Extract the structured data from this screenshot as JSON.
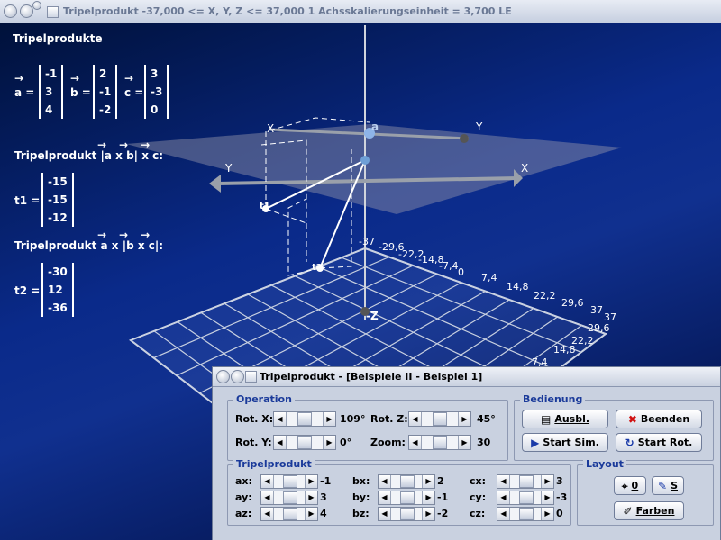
{
  "window": {
    "title": "Tripelprodukt   -37,000 <= X, Y, Z <= 37,000    1 Achsskalierungseinheit = 3,700 LE"
  },
  "scene": {
    "heading": "Tripelprodukte",
    "arrow": "→",
    "vectors": [
      {
        "name": "a",
        "values": [
          "-1",
          "3",
          "4"
        ]
      },
      {
        "name": "b",
        "values": [
          "2",
          "-1",
          "-2"
        ]
      },
      {
        "name": "c",
        "values": [
          "3",
          "-3",
          "0"
        ]
      }
    ],
    "t1_heading": "Tripelprodukt |a x b| x c:",
    "t1": {
      "name": "t1",
      "values": [
        "-15",
        "-15",
        "-12"
      ]
    },
    "t2_heading": "Tripelprodukt  a x |b x c|:",
    "t2": {
      "name": "t2",
      "values": [
        "-30",
        "12",
        "-36"
      ]
    },
    "axis_labels": {
      "x": "X",
      "y": "Y",
      "z": "Z"
    },
    "point_labels": {
      "a": "a",
      "t1": "t1",
      "t2": "t2"
    },
    "ticks_x": [
      "-37",
      "-29,6",
      "-22,2",
      "-14,8",
      "-7,4",
      "0",
      "7,4",
      "14,8",
      "22,2",
      "29,6",
      "37"
    ],
    "ticks_y": [
      "37",
      "29,6",
      "22,2",
      "14,8",
      "7,4"
    ],
    "z_label_bottom": "-Z",
    "colors": {
      "bg_top": "#00113a",
      "bg_mid": "#10308f",
      "grid": "#c8d0e0"
    }
  },
  "dialog": {
    "title": "Tripelprodukt - [Beispiele II - Beispiel 1]",
    "operation": {
      "title": "Operation",
      "rot_x_label": "Rot. X:",
      "rot_x_value": "109°",
      "rot_z_label": "Rot. Z:",
      "rot_z_value": "45°",
      "rot_y_label": "Rot. Y:",
      "rot_y_value": "0°",
      "zoom_label": "Zoom:",
      "zoom_value": "30"
    },
    "bedienung": {
      "title": "Bedienung",
      "ausbl": "Ausbl.",
      "beenden": "Beenden",
      "start_sim": "Start Sim.",
      "start_rot": "Start Rot."
    },
    "tripel": {
      "title": "Tripelprodukt",
      "rows": [
        {
          "l1": "ax:",
          "v1": "-1",
          "l2": "bx:",
          "v2": "2",
          "l3": "cx:",
          "v3": "3"
        },
        {
          "l1": "ay:",
          "v1": "3",
          "l2": "by:",
          "v2": "-1",
          "l3": "cy:",
          "v3": "-3"
        },
        {
          "l1": "az:",
          "v1": "4",
          "l2": "bz:",
          "v2": "-2",
          "l3": "cz:",
          "v3": "0"
        }
      ]
    },
    "layout": {
      "title": "Layout",
      "zero": "0",
      "s": "S",
      "farben": "Farben"
    }
  }
}
